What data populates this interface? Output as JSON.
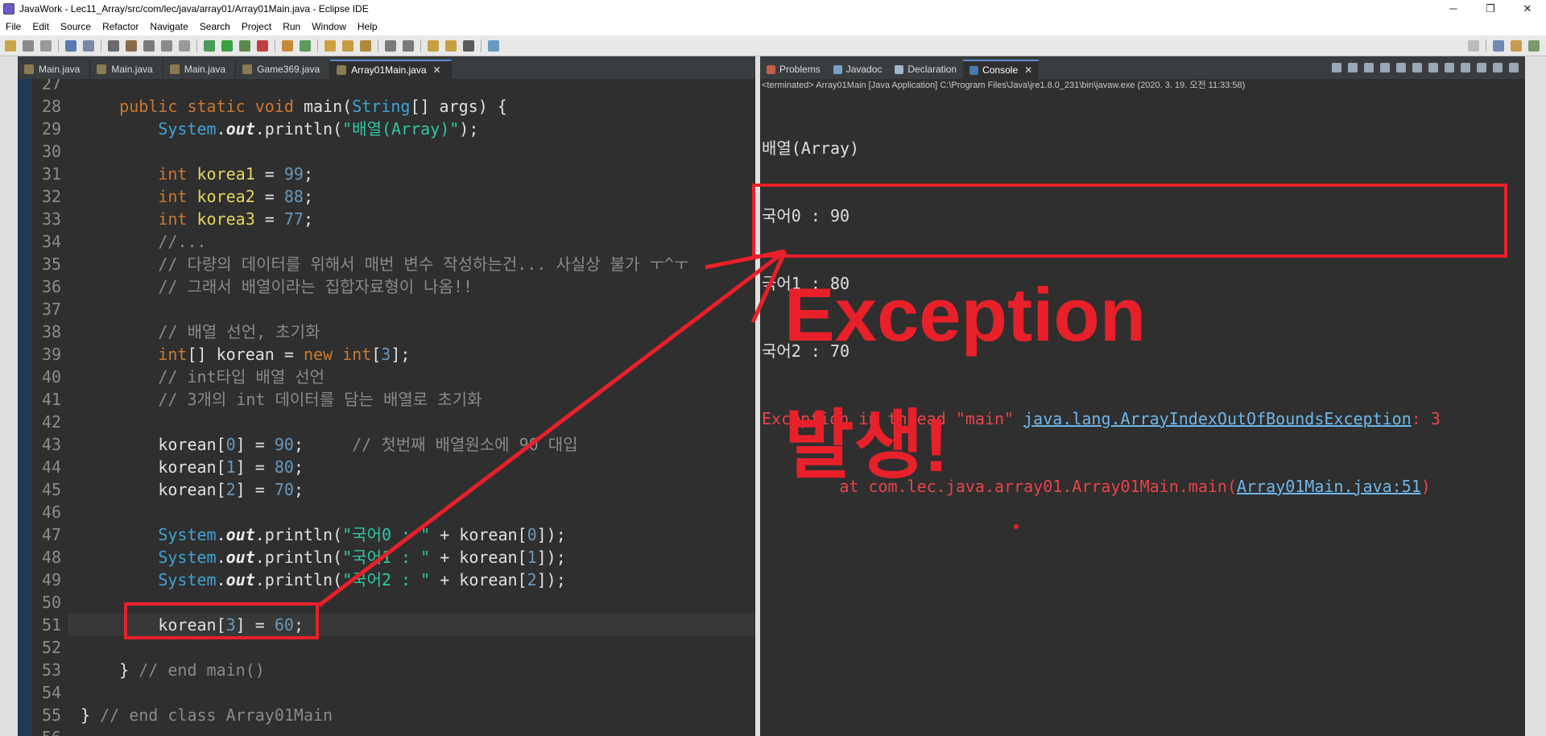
{
  "window": {
    "title": "JavaWork - Lec11_Array/src/com/lec/java/array01/Array01Main.java - Eclipse IDE",
    "controls": [
      "─",
      "❐",
      "✕"
    ]
  },
  "menu": [
    "File",
    "Edit",
    "Source",
    "Refactor",
    "Navigate",
    "Search",
    "Project",
    "Run",
    "Window",
    "Help"
  ],
  "editor": {
    "tabs": [
      {
        "label": "Main.java"
      },
      {
        "label": "Main.java"
      },
      {
        "label": "Main.java"
      },
      {
        "label": "Game369.java"
      },
      {
        "label": "Array01Main.java",
        "active": true
      }
    ],
    "current_line": 51,
    "lines": [
      {
        "n": "27",
        "text": ""
      },
      {
        "n": "28",
        "text": "    public static void main(String[] args) {"
      },
      {
        "n": "29",
        "text": "        System.out.println(\"배열(Array)\");"
      },
      {
        "n": "30",
        "text": ""
      },
      {
        "n": "31",
        "text": "        int korea1 = 99;"
      },
      {
        "n": "32",
        "text": "        int korea2 = 88;"
      },
      {
        "n": "33",
        "text": "        int korea3 = 77;"
      },
      {
        "n": "34",
        "text": "        //..."
      },
      {
        "n": "35",
        "text": "        // 다량의 데이터를 위해서 매번 변수 작성하는건... 사실상 불가 ㅜ^ㅜ"
      },
      {
        "n": "36",
        "text": "        // 그래서 배열이라는 집합자료형이 나옴!!"
      },
      {
        "n": "37",
        "text": ""
      },
      {
        "n": "38",
        "text": "        // 배열 선언, 초기화"
      },
      {
        "n": "39",
        "text": "        int[] korean = new int[3];"
      },
      {
        "n": "40",
        "text": "        // int타입 배열 선언"
      },
      {
        "n": "41",
        "text": "        // 3개의 int 데이터를 담는 배열로 초기화"
      },
      {
        "n": "42",
        "text": ""
      },
      {
        "n": "43",
        "text": "        korean[0] = 90;     // 첫번째 배열원소에 90 대입"
      },
      {
        "n": "44",
        "text": "        korean[1] = 80;"
      },
      {
        "n": "45",
        "text": "        korean[2] = 70;"
      },
      {
        "n": "46",
        "text": ""
      },
      {
        "n": "47",
        "text": "        System.out.println(\"국어0 : \" + korean[0]);"
      },
      {
        "n": "48",
        "text": "        System.out.println(\"국어1 : \" + korean[1]);"
      },
      {
        "n": "49",
        "text": "        System.out.println(\"국어2 : \" + korean[2]);"
      },
      {
        "n": "50",
        "text": ""
      },
      {
        "n": "51",
        "text": "        korean[3] = 60;"
      },
      {
        "n": "52",
        "text": ""
      },
      {
        "n": "53",
        "text": "    } // end main()"
      },
      {
        "n": "54",
        "text": ""
      },
      {
        "n": "55",
        "text": "} // end class Array01Main"
      },
      {
        "n": "56",
        "text": ""
      }
    ]
  },
  "console": {
    "tabs": [
      {
        "label": "Problems",
        "color": "#c45c4a"
      },
      {
        "label": "Javadoc",
        "color": "#7aa0c4"
      },
      {
        "label": "Declaration",
        "color": "#9fb7c8"
      },
      {
        "label": "Console",
        "color": "#4a78b0",
        "active": true
      }
    ],
    "status": "<terminated> Array01Main [Java Application] C:\\Program Files\\Java\\jre1.8.0_231\\bin\\javaw.exe (2020. 3. 19. 오전 11:33:58)",
    "output": [
      "배열(Array)",
      "국어0 : 90",
      "국어1 : 80",
      "국어2 : 70"
    ],
    "exception": {
      "prefix": "Exception in thread \"main\" ",
      "link": "java.lang.ArrayIndexOutOfBoundsException",
      "suffix": ": 3",
      "at_prefix": "        at com.lec.java.array01.Array01Main.main(",
      "at_link": "Array01Main.java:51",
      "at_suffix": ")"
    }
  },
  "annotation": {
    "line1": "Exception",
    "line2": "발생!",
    "color": "#e8202a"
  }
}
